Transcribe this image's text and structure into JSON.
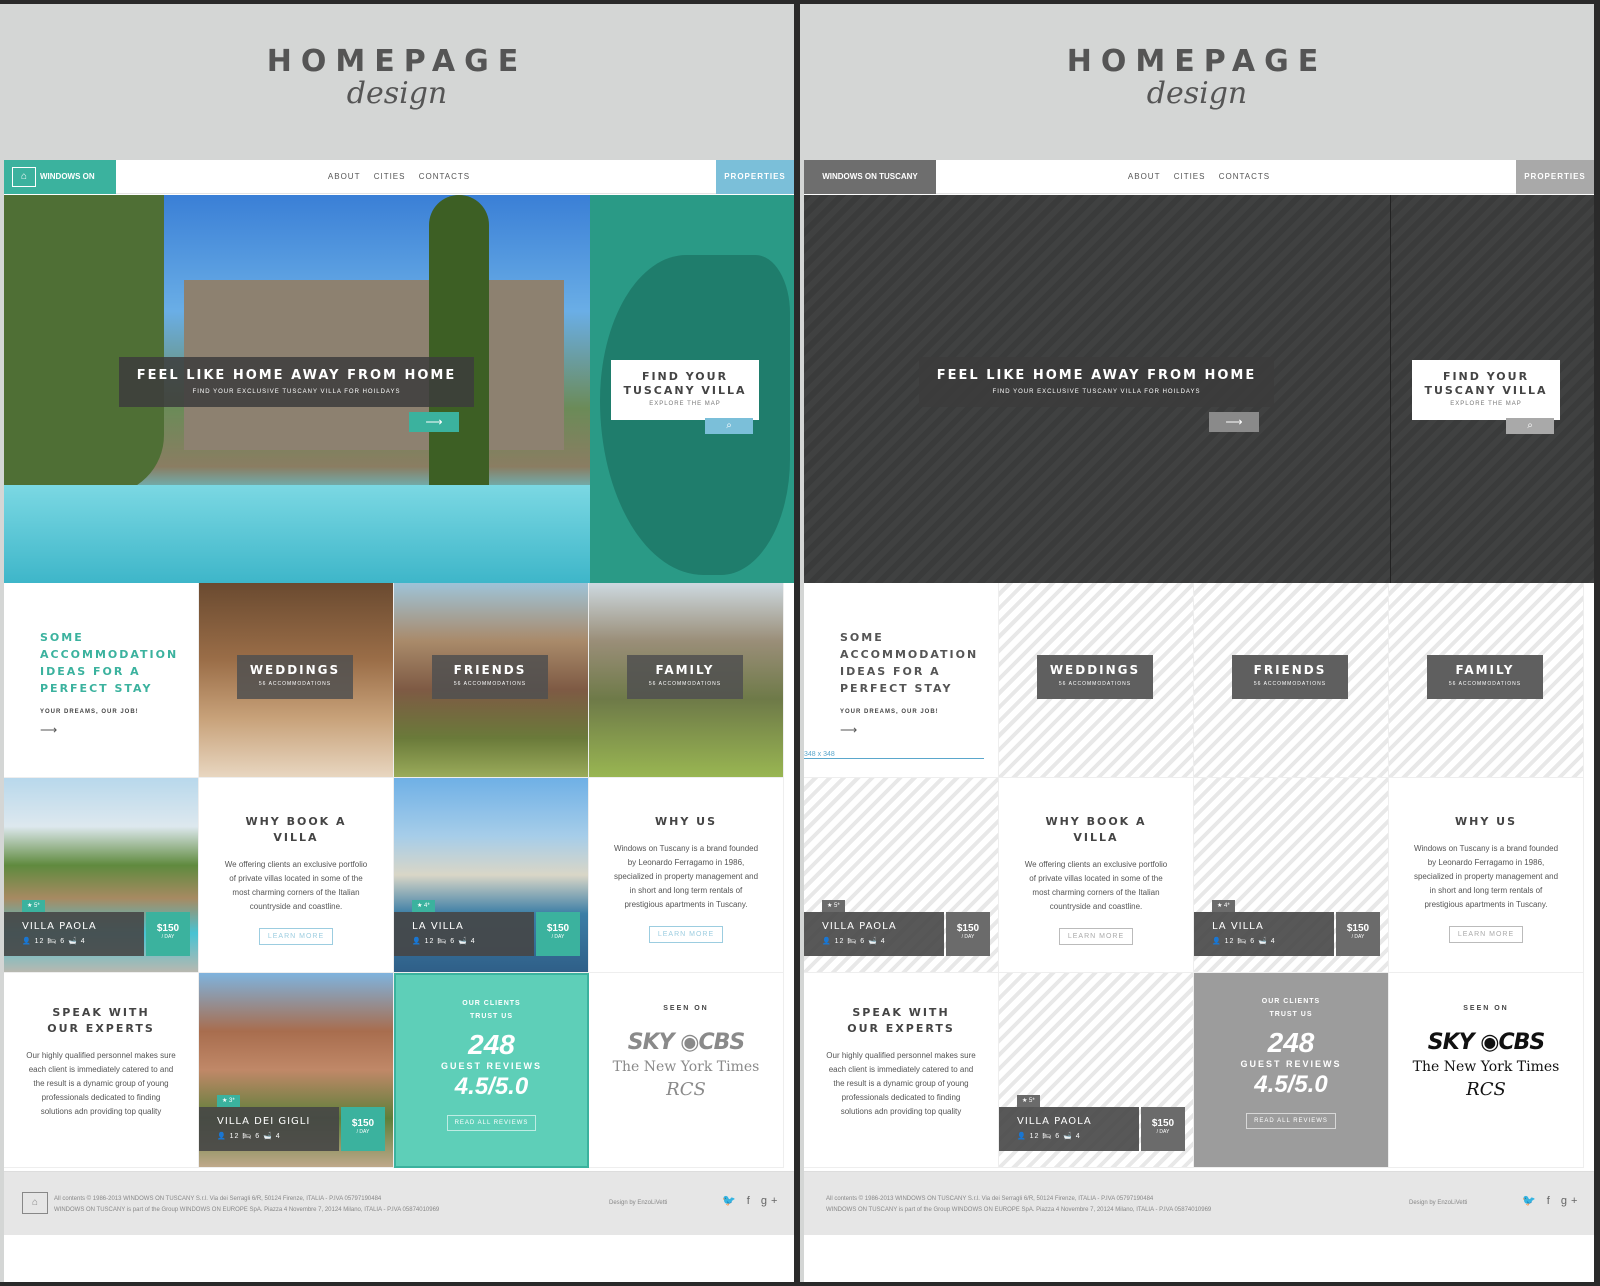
{
  "title": "HOMEPAGE",
  "subtitle": "design",
  "nav": {
    "logo_text": "WINDOWS ON TUSCANY",
    "wire_logo_text": "WINDOWS ON TUSCANY",
    "items": [
      "ABOUT",
      "CITIES",
      "CONTACTS"
    ],
    "properties": "PROPERTIES"
  },
  "hero": {
    "title": "FEEL LIKE HOME AWAY FROM HOME",
    "subtitle": "FIND YOUR EXCLUSIVE TUSCANY VILLA FOR HOILDAYS",
    "arrow": "⟶"
  },
  "map": {
    "title_line1": "FIND YOUR",
    "title_line2": "TUSCANY VILLA",
    "subtitle": "EXPLORE THE MAP",
    "search_icon": "⌕"
  },
  "intro": {
    "lines": [
      "SOME",
      "ACCOMMODATION",
      "IDEAS FOR A",
      "PERFECT STAY"
    ],
    "tagline": "YOUR DREAMS, OUR JOB!",
    "arrow": "⟶",
    "dimension": "348 x 348"
  },
  "categories": [
    {
      "name": "WEDDINGS",
      "count": "56 ACCOMMODATIONS"
    },
    {
      "name": "FRIENDS",
      "count": "56 ACCOMMODATIONS"
    },
    {
      "name": "FAMILY",
      "count": "56 ACCOMMODATIONS"
    }
  ],
  "villas": [
    {
      "name": "VILLA PAOLA",
      "stars": "★ 5*",
      "info": "👤 12  🛏 6  🛁 4",
      "price": "$150",
      "per": "/ DAY"
    },
    {
      "name": "LA VILLA",
      "stars": "★ 4*",
      "info": "👤 12  🛏 6  🛁 4",
      "price": "$150",
      "per": "/ DAY"
    },
    {
      "name": "VILLA DEI GIGLI",
      "stars": "★ 3*",
      "info": "👤 12  🛏 6  🛁 4",
      "price": "$150",
      "per": "/ DAY"
    },
    {
      "name": "VILLA PAOLA",
      "stars": "★ 5*",
      "info": "👤 12  🛏 6  🛁 4",
      "price": "$150",
      "per": "/ DAY"
    }
  ],
  "why_book": {
    "title": "WHY BOOK A VILLA",
    "text": "We offering clients an exclusive portfolio of private villas located in some of the most charming corners of the Italian countryside and coastline.",
    "button": "LEARN MORE"
  },
  "why_us": {
    "title": "WHY US",
    "text": "Windows on Tuscany is a brand founded by Leonardo Ferragamo in 1986, specialized in property management and in short and long term rentals of prestigious apartments in Tuscany.",
    "button": "LEARN MORE"
  },
  "experts": {
    "title_line1": "SPEAK WITH",
    "title_line2": "OUR EXPERTS",
    "text": "Our highly qualified personnel makes sure each client is immediately catered to and the result is a dynamic group of young professionals dedicated to finding solutions adn providing top quality"
  },
  "reviews": {
    "line1": "OUR CLIENTS",
    "line2": "TRUST US",
    "count": "248",
    "label": "GUEST REVIEWS",
    "rating": "4.5/5.0",
    "button": "READ ALL REVIEWS"
  },
  "seen_on": {
    "title": "SEEN ON",
    "logo1": "SKY ◉CBS",
    "logo2": "The New York Times",
    "logo3": "RCS"
  },
  "footer": {
    "line1": "All contents © 1986-2013 WINDOWS ON TUSCANY S.r.l. Via dei Serragli 6/R, 50124 Firenze, ITALIA - P.IVA 05797190484",
    "line2": "WINDOWS ON TUSCANY is part of the Group WINDOWS ON EUROPE SpA. Piazza 4 Novembre 7, 20124 Milano, ITALIA - P.IVA 05874010969",
    "design": "Design by EnzoLiVetti",
    "social": "🐦 f g+"
  },
  "colors": {
    "accent": "#3bb29e",
    "blue": "#7bbfd9",
    "wire": "#6e6e6e"
  }
}
